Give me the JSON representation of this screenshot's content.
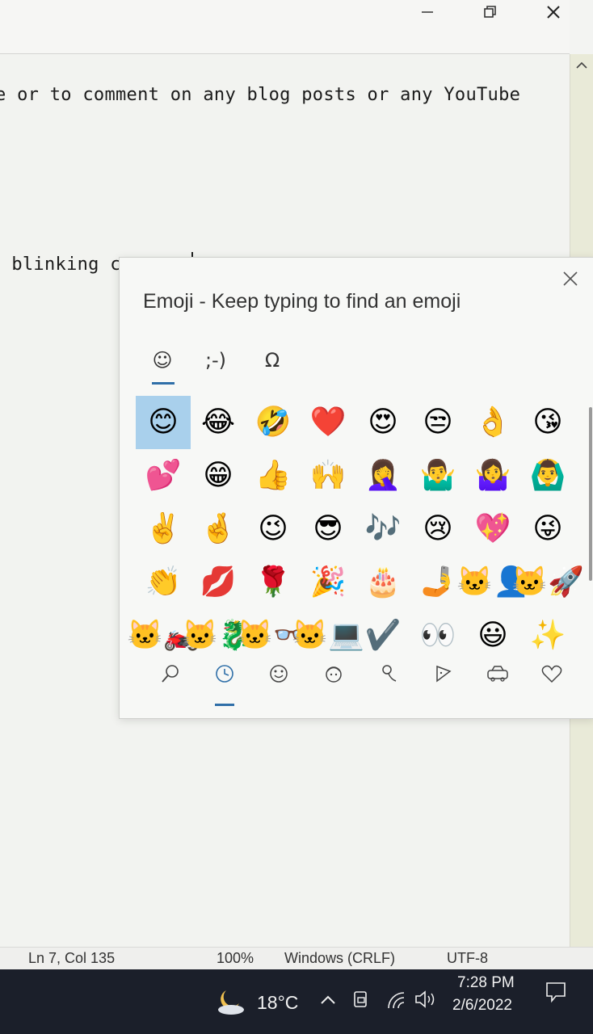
{
  "editor": {
    "lines": [
      "e or to comment on any blog posts or any YouTube",
      "blinking cursor."
    ]
  },
  "emoji_panel": {
    "title": "Emoji - Keep typing to find an emoji",
    "tabs": [
      {
        "label": "☺",
        "name": "tab-emoji"
      },
      {
        "label": ";-)",
        "name": "tab-kaomoji"
      },
      {
        "label": "Ω",
        "name": "tab-symbols"
      }
    ],
    "emojis": [
      "😊",
      "😂",
      "🤣",
      "❤️",
      "😍",
      "😒",
      "👌",
      "😘",
      "💕",
      "😁",
      "👍",
      "🙌",
      "🤦‍♀️",
      "🤷‍♂️",
      "🤷‍♀️",
      "🙆‍♂️",
      "✌️",
      "🤞",
      "😉",
      "😎",
      "🎶",
      "😢",
      "💖",
      "😜",
      "👏",
      "💋",
      "🌹",
      "🎉",
      "🎂",
      "🤳",
      "🐱‍👤",
      "🐱‍🚀",
      "🐱‍🏍",
      "🐱‍🐉",
      "🐱‍👓",
      "🐱‍💻",
      "✔️",
      "👀",
      "😃",
      "✨"
    ],
    "categories": [
      {
        "name": "search-category-icon"
      },
      {
        "name": "recent-category-icon"
      },
      {
        "name": "smiley-category-icon"
      },
      {
        "name": "people-category-icon"
      },
      {
        "name": "celebration-category-icon"
      },
      {
        "name": "food-category-icon"
      },
      {
        "name": "travel-category-icon"
      },
      {
        "name": "heart-category-icon"
      }
    ],
    "selected_index": 0
  },
  "statusbar": {
    "position": "Ln 7, Col 135",
    "zoom": "100%",
    "line_ending": "Windows (CRLF)",
    "encoding": "UTF-8"
  },
  "taskbar": {
    "temperature": "18°C",
    "time": "7:28 PM",
    "date": "2/6/2022"
  },
  "colors": {
    "accent": "#2f6fa8",
    "selection": "#a9d0ec",
    "taskbar": "#1b1f2a"
  }
}
